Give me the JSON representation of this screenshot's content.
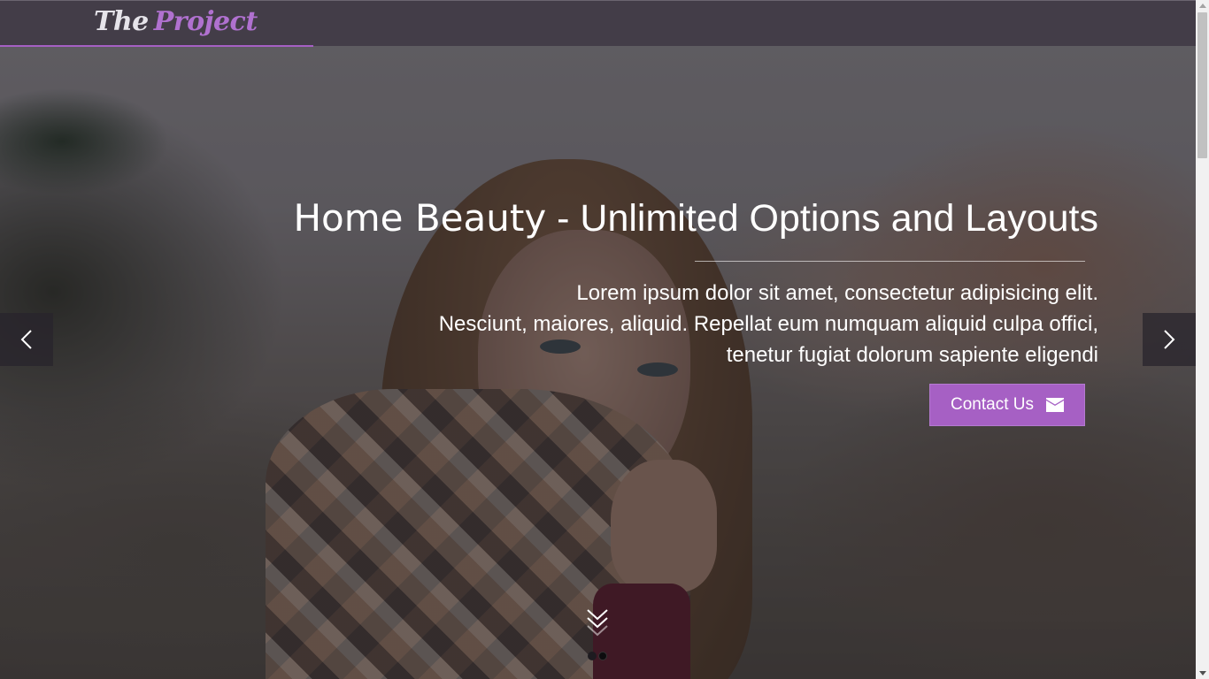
{
  "header": {
    "logo_word1": "The",
    "logo_word2": "Project"
  },
  "slide": {
    "title_word1": "Home Beauty",
    "title_rest": " - Unlimited Options and Layouts",
    "text_line1": "Lorem ipsum dolor sit amet, consectetur adipisicing elit.",
    "text_line2": "Nesciunt, maiores, aliquid. Repellat eum numquam aliquid culpa offici,",
    "text_line3": "tenetur fugiat dolorum sapiente eligendi",
    "cta_label": "Contact Us",
    "cta_icon": "envelope-icon"
  },
  "carousel": {
    "prev_icon": "chevron-left-icon",
    "next_icon": "chevron-right-icon",
    "scroll_icon": "double-chevron-down-icon",
    "slide_count": 2,
    "active_index": 1
  },
  "colors": {
    "accent": "#a660c4",
    "header_bg": "#423c46",
    "text": "#ffffff"
  }
}
